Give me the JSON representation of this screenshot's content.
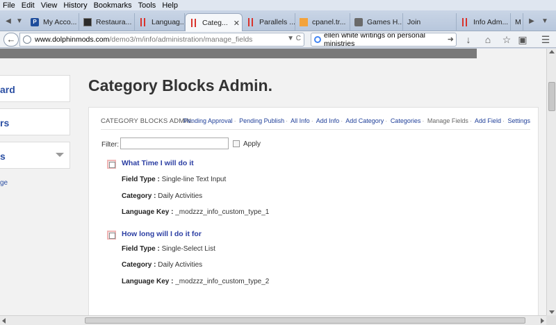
{
  "menu": {
    "file": "File",
    "edit": "Edit",
    "view": "View",
    "history": "History",
    "bookmarks": "Bookmarks",
    "tools": "Tools",
    "help": "Help"
  },
  "tabs": [
    {
      "label": "My Acco...",
      "icon": "paypal-favicon"
    },
    {
      "label": "Restaura...",
      "icon": "dark-favicon"
    },
    {
      "label": "Languag...",
      "icon": "red-bars-favicon"
    },
    {
      "label": "Categ...",
      "icon": "red-bars-favicon",
      "active": true
    },
    {
      "label": "Parallels ...",
      "icon": "red-bars-favicon"
    },
    {
      "label": "cpanel.tr...",
      "icon": "cpanel-favicon"
    },
    {
      "label": "Games H...",
      "icon": "games-favicon"
    },
    {
      "label": "Join",
      "icon": "none"
    },
    {
      "label": "Info Adm...",
      "icon": "red-bars-favicon"
    },
    {
      "label": "M",
      "icon": "none"
    }
  ],
  "navbar": {
    "url_domain": "www.dolphinmods.com",
    "url_path": "/demo3/m/info/administration/manage_fields",
    "search_value": "ellen white writings on personal ministries"
  },
  "sidebar": {
    "items": [
      "ard",
      "rs",
      "s"
    ],
    "sub_link": "ge"
  },
  "page": {
    "title": "Category Blocks Admin."
  },
  "panel": {
    "title": "CATEGORY BLOCKS ADMIN.",
    "nav": [
      {
        "label": "Pending Approval",
        "current": false
      },
      {
        "label": "Pending Publish",
        "current": false
      },
      {
        "label": "All Info",
        "current": false
      },
      {
        "label": "Add Info",
        "current": false
      },
      {
        "label": "Add Category",
        "current": false
      },
      {
        "label": "Categories",
        "current": false
      },
      {
        "label": "Manage Fields",
        "current": true
      },
      {
        "label": "Add Field",
        "current": false
      },
      {
        "label": "Settings",
        "current": false
      }
    ],
    "filter_label": "Filter:",
    "filter_value": "",
    "apply_label": "Apply"
  },
  "fields": [
    {
      "title": "What Time I will do it",
      "type_label": "Field Type :",
      "type_value": "Single-line Text Input",
      "category_label": "Category :",
      "category_value": "Daily Activities",
      "key_label": "Language Key :",
      "key_value": "_modzzz_info_custom_type_1"
    },
    {
      "title": "How long will I do it for",
      "type_label": "Field Type :",
      "type_value": "Single-Select List",
      "category_label": "Category :",
      "category_value": "Daily Activities",
      "key_label": "Language Key :",
      "key_value": "_modzzz_info_custom_type_2"
    }
  ]
}
